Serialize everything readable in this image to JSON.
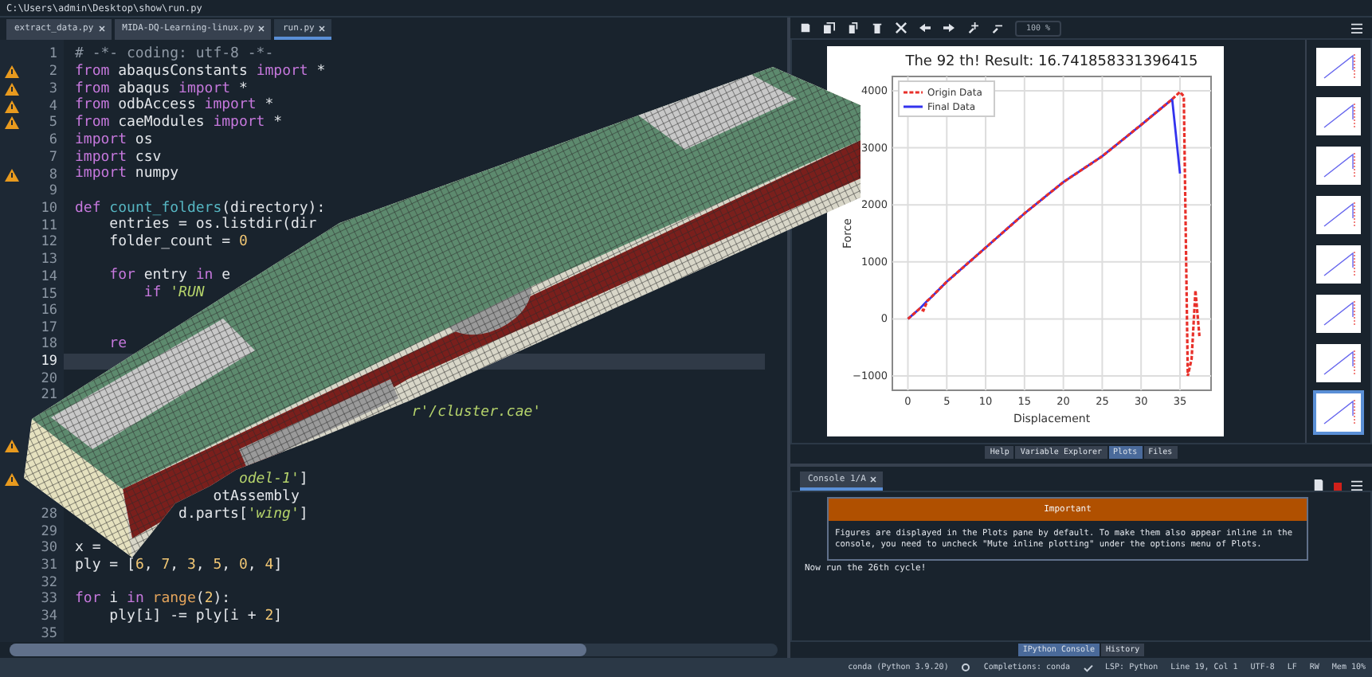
{
  "path_bar": {
    "path": "C:\\Users\\admin\\Desktop\\show\\run.py"
  },
  "editor": {
    "tabs": [
      {
        "label": "extract_data.py",
        "selected": false
      },
      {
        "label": "MIDA-DQ-Learning-linux.py",
        "selected": false
      },
      {
        "label": "run.py",
        "selected": true
      }
    ],
    "lines": [
      {
        "number": "1",
        "warning": false,
        "current": false,
        "segments": [
          {
            "kind": "comment",
            "text": "# -*- coding: utf-8 -*-"
          }
        ]
      },
      {
        "number": "2",
        "warning": true,
        "current": false,
        "segments": [
          {
            "kind": "keyword",
            "text": "from"
          },
          {
            "kind": "plain",
            "text": " abaqusConstants "
          },
          {
            "kind": "keyword",
            "text": "import"
          },
          {
            "kind": "plain",
            "text": " *"
          }
        ]
      },
      {
        "number": "3",
        "warning": true,
        "current": false,
        "segments": [
          {
            "kind": "keyword",
            "text": "from"
          },
          {
            "kind": "plain",
            "text": " abaqus "
          },
          {
            "kind": "keyword",
            "text": "import"
          },
          {
            "kind": "plain",
            "text": " *"
          }
        ]
      },
      {
        "number": "4",
        "warning": true,
        "current": false,
        "segments": [
          {
            "kind": "keyword",
            "text": "from"
          },
          {
            "kind": "plain",
            "text": " odbAccess "
          },
          {
            "kind": "keyword",
            "text": "import"
          },
          {
            "kind": "plain",
            "text": " *"
          }
        ]
      },
      {
        "number": "5",
        "warning": true,
        "current": false,
        "segments": [
          {
            "kind": "keyword",
            "text": "from"
          },
          {
            "kind": "plain",
            "text": " caeModules "
          },
          {
            "kind": "keyword",
            "text": "import"
          },
          {
            "kind": "plain",
            "text": " *"
          }
        ]
      },
      {
        "number": "6",
        "warning": false,
        "current": false,
        "segments": [
          {
            "kind": "keyword",
            "text": "import"
          },
          {
            "kind": "plain",
            "text": " os"
          }
        ]
      },
      {
        "number": "7",
        "warning": false,
        "current": false,
        "segments": [
          {
            "kind": "keyword",
            "text": "import"
          },
          {
            "kind": "plain",
            "text": " csv"
          }
        ]
      },
      {
        "number": "8",
        "warning": true,
        "current": false,
        "segments": [
          {
            "kind": "keyword",
            "text": "import"
          },
          {
            "kind": "plain",
            "text": " numpy"
          }
        ]
      },
      {
        "number": "9",
        "warning": false,
        "current": false
      },
      {
        "number": "10",
        "warning": false,
        "current": false,
        "segments": [
          {
            "kind": "keyword",
            "text": "def"
          },
          {
            "kind": "function",
            "text": " count_folders"
          },
          {
            "kind": "plain",
            "text": "(directory):"
          }
        ]
      },
      {
        "number": "11",
        "warning": false,
        "current": false,
        "segments": [
          {
            "kind": "plain",
            "text": "    entries = os.listdir(dir"
          }
        ]
      },
      {
        "number": "12",
        "warning": false,
        "current": false,
        "segments": [
          {
            "kind": "plain",
            "text": "    folder_count = "
          },
          {
            "kind": "number",
            "text": "0"
          }
        ]
      },
      {
        "number": "13",
        "warning": false,
        "current": false
      },
      {
        "number": "14",
        "warning": false,
        "current": false,
        "segments": [
          {
            "kind": "keyword",
            "text": "    for"
          },
          {
            "kind": "plain",
            "text": " entry "
          },
          {
            "kind": "keyword",
            "text": "in"
          },
          {
            "kind": "plain",
            "text": " e"
          }
        ]
      },
      {
        "number": "15",
        "warning": false,
        "current": false,
        "segments": [
          {
            "kind": "keyword",
            "text": "        if"
          },
          {
            "kind": "string",
            "text": " 'RUN"
          }
        ]
      },
      {
        "number": "16",
        "warning": false,
        "current": false
      },
      {
        "number": "17",
        "warning": false,
        "current": false
      },
      {
        "number": "18",
        "warning": false,
        "current": false,
        "segments": [
          {
            "kind": "keyword",
            "text": "    re"
          }
        ]
      },
      {
        "number": "19",
        "warning": false,
        "current": true
      },
      {
        "number": "20",
        "warning": false,
        "current": false
      },
      {
        "number": "21",
        "warning": false,
        "current": false
      },
      {
        "warning": false,
        "current": false,
        "segments": [
          {
            "kind": "string",
            "text": "                                       r'/cluster.cae'"
          }
        ]
      },
      {
        "warning": false,
        "current": false
      },
      {
        "warning": true,
        "current": false
      },
      {
        "warning": false,
        "current": false
      },
      {
        "warning": true,
        "current": false,
        "segments": [
          {
            "kind": "string",
            "text": "                   odel-1'"
          },
          {
            "kind": "plain",
            "text": "]"
          }
        ]
      },
      {
        "warning": false,
        "current": false,
        "segments": [
          {
            "kind": "plain",
            "text": "                otAssembly"
          }
        ]
      },
      {
        "number": "28",
        "warning": false,
        "current": false,
        "segments": [
          {
            "kind": "plain",
            "text": "            d.parts["
          },
          {
            "kind": "string",
            "text": "'wing'"
          },
          {
            "kind": "plain",
            "text": "]"
          }
        ]
      },
      {
        "number": "29",
        "warning": false,
        "current": false
      },
      {
        "number": "30",
        "warning": false,
        "current": false,
        "segments": [
          {
            "kind": "plain",
            "text": "x ="
          }
        ]
      },
      {
        "number": "31",
        "warning": false,
        "current": false,
        "segments": [
          {
            "kind": "plain",
            "text": "ply = ["
          },
          {
            "kind": "number",
            "text": "6"
          },
          {
            "kind": "plain",
            "text": ", "
          },
          {
            "kind": "number",
            "text": "7"
          },
          {
            "kind": "plain",
            "text": ", "
          },
          {
            "kind": "number",
            "text": "3"
          },
          {
            "kind": "plain",
            "text": ", "
          },
          {
            "kind": "number",
            "text": "5"
          },
          {
            "kind": "plain",
            "text": ", "
          },
          {
            "kind": "number",
            "text": "0"
          },
          {
            "kind": "plain",
            "text": ", "
          },
          {
            "kind": "number",
            "text": "4"
          },
          {
            "kind": "plain",
            "text": "]"
          }
        ]
      },
      {
        "number": "32",
        "warning": false,
        "current": false
      },
      {
        "number": "33",
        "warning": false,
        "current": false,
        "segments": [
          {
            "kind": "keyword",
            "text": "for"
          },
          {
            "kind": "plain",
            "text": " i "
          },
          {
            "kind": "keyword",
            "text": "in"
          },
          {
            "kind": "builtin",
            "text": " range"
          },
          {
            "kind": "plain",
            "text": "("
          },
          {
            "kind": "number",
            "text": "2"
          },
          {
            "kind": "plain",
            "text": "):"
          }
        ]
      },
      {
        "number": "34",
        "warning": false,
        "current": false,
        "segments": [
          {
            "kind": "plain",
            "text": "    ply[i] -= ply[i + "
          },
          {
            "kind": "number",
            "text": "2"
          },
          {
            "kind": "plain",
            "text": "]"
          }
        ]
      },
      {
        "number": "35",
        "warning": false,
        "current": false
      }
    ]
  },
  "plots": {
    "zoom": "100 %",
    "chart_data": {
      "type": "line",
      "title": "The 92 th! Result: 16.741858331396415",
      "xlabel": "Displacement",
      "ylabel": "Force",
      "grid": true,
      "legend": true,
      "x": [
        0,
        1.5,
        2,
        2.5,
        3,
        5,
        10,
        15,
        20,
        25,
        30,
        34,
        35,
        35.5,
        36,
        36.5,
        37,
        37.5
      ],
      "series": [
        {
          "name": "Origin Data",
          "color": "#e8302a",
          "line_style": "dashed",
          "values": [
            0,
            180,
            150,
            320,
            380,
            650,
            1250,
            1850,
            2400,
            2850,
            3400,
            3850,
            3980,
            3900,
            -1000,
            -700,
            500,
            -300
          ]
        },
        {
          "name": "Final Data",
          "color": "#3333ee",
          "line_style": "solid",
          "values": [
            0,
            180,
            250,
            320,
            380,
            650,
            1250,
            1850,
            2400,
            2850,
            3400,
            3850,
            2550,
            null,
            null,
            null,
            null,
            null
          ]
        }
      ],
      "xlim": [
        -2,
        39
      ],
      "ylim": [
        -1250,
        4250
      ],
      "xticks": [
        0,
        5,
        10,
        15,
        20,
        25,
        30,
        35
      ],
      "yticks": [
        -1000,
        0,
        1000,
        2000,
        3000,
        4000
      ]
    },
    "thumbnails": [
      {
        "selected": false
      },
      {
        "selected": false
      },
      {
        "selected": false
      },
      {
        "selected": false
      },
      {
        "selected": false
      },
      {
        "selected": false
      },
      {
        "selected": false
      },
      {
        "selected": true
      }
    ],
    "tabs": [
      {
        "label": "Help",
        "selected": false
      },
      {
        "label": "Variable Explorer",
        "selected": false
      },
      {
        "label": "Plots",
        "selected": true
      },
      {
        "label": "Files",
        "selected": false
      }
    ]
  },
  "console": {
    "tab": "Console 1/A",
    "notice": {
      "title": "Important",
      "text": "Figures are displayed in the Plots pane by default. To make them also appear inline in the console, you need to uncheck \"Mute inline plotting\" under the options menu of Plots."
    },
    "output": "Now run the 26th cycle!",
    "tabs": [
      {
        "label": "IPython Console",
        "selected": true
      },
      {
        "label": "History",
        "selected": false
      }
    ]
  },
  "status_bar": {
    "env": "conda (Python 3.9.20)",
    "completions": "Completions: conda",
    "lsp": "LSP: Python",
    "position": "Line 19, Col 1",
    "encoding": "UTF-8",
    "eol": "LF",
    "mode": "RW",
    "memory": "Mem 10%"
  }
}
